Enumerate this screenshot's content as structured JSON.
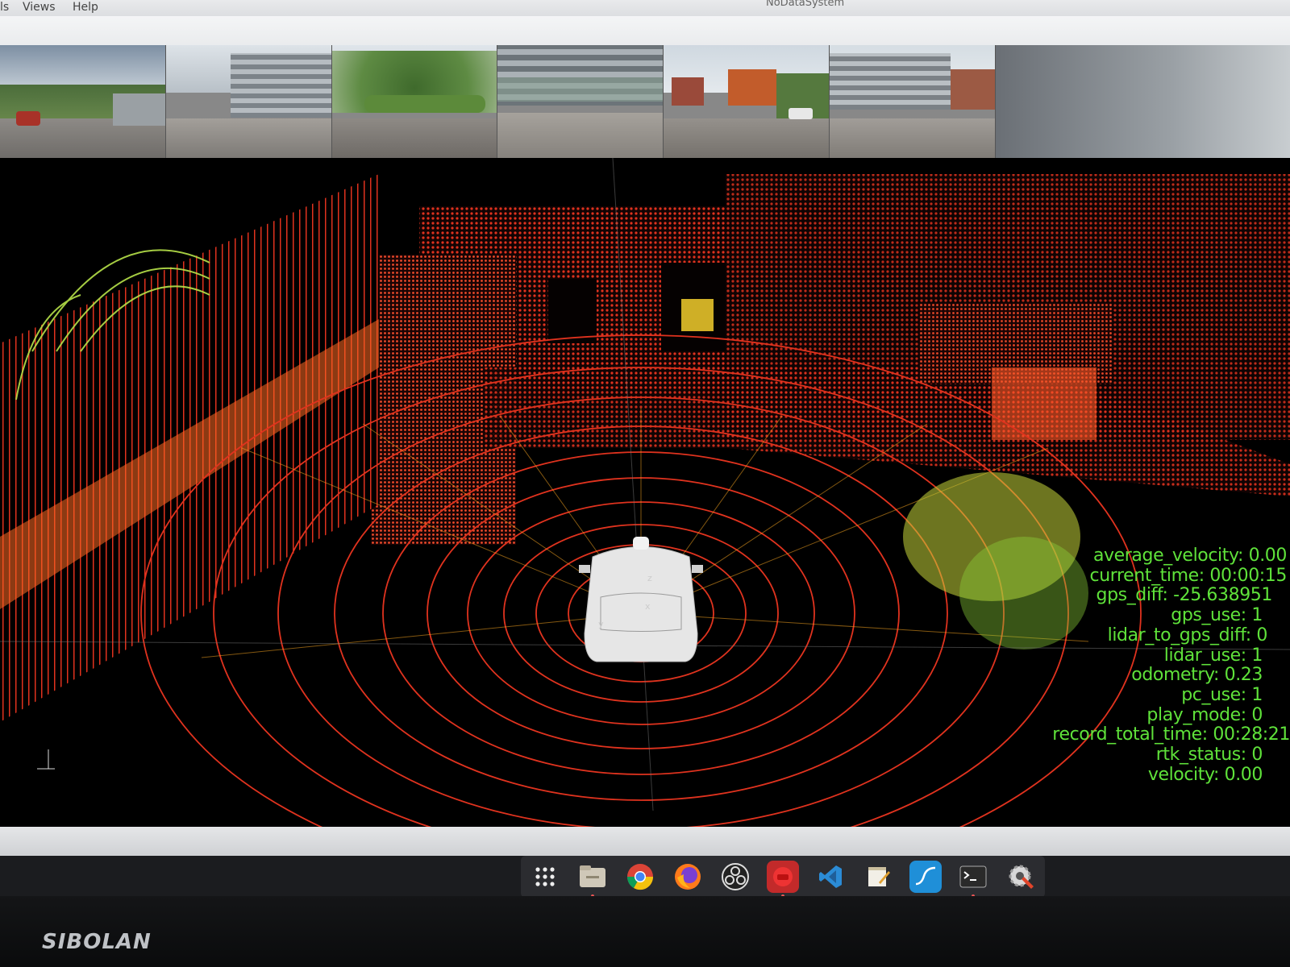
{
  "menu": {
    "items": [
      "ls",
      "Views",
      "Help"
    ],
    "window_title": "NoDataSystem"
  },
  "overlay": {
    "lines": [
      "average_velocity: 0.00",
      "current_time: 00:00:15",
      "gps_diff: -25.638951",
      "gps_use: 1",
      "lidar_to_gps_diff: 0",
      "lidar_use: 1",
      "odometry: 0.23",
      "pc_use: 1",
      "play_mode: 0",
      "record_total_time: 00:28:21",
      "rtk_status: 0",
      "velocity: 0.00"
    ],
    "color": "#5fe23a"
  },
  "axes": {
    "z": "z",
    "y": "y",
    "x": "x"
  },
  "dock": {
    "items": [
      "apps-grid-icon",
      "files-icon",
      "chrome-icon",
      "firefox-icon",
      "obs-icon",
      "app-red-icon",
      "vscode-icon",
      "text-editor-icon",
      "monitor-icon",
      "terminal-icon",
      "settings-icon"
    ]
  },
  "bezel": {
    "brand": "SIBOLAN"
  },
  "colors": {
    "lidar_far": "#e0321e",
    "lidar_near": "#d6e83a",
    "viewer_bg": "#000000"
  }
}
